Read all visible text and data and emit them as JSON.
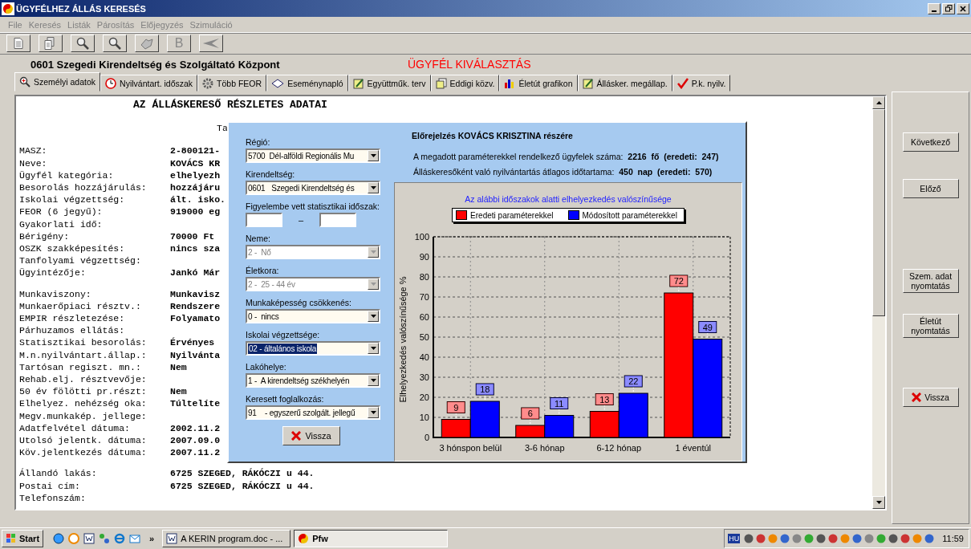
{
  "window": {
    "title": "ÜGYFÉLHEZ ÁLLÁS KERESÉS"
  },
  "menu": [
    {
      "label": "File",
      "disabled": true
    },
    {
      "label": "Keresés",
      "disabled": true
    },
    {
      "label": "Listák",
      "disabled": true
    },
    {
      "label": "Párosítás",
      "disabled": true
    },
    {
      "label": "Előjegyzés",
      "disabled": true
    },
    {
      "label": "Szimuláció",
      "disabled": true
    }
  ],
  "toolbar": [
    {
      "kind": "page"
    },
    {
      "kind": "pages"
    },
    {
      "kind": "zoom"
    },
    {
      "kind": "zoom"
    },
    {
      "kind": "print"
    },
    {
      "kind": "letter",
      "label": "B"
    },
    {
      "kind": "back"
    }
  ],
  "header": {
    "office": "0601  Szegedi Kirendeltség és Szolgáltató Központ",
    "mode": "ÜGYFÉL KIVÁLASZTÁS"
  },
  "tabs": [
    {
      "label": "Személyi adatok",
      "kind": "zoom",
      "selected": true
    },
    {
      "label": "Nyilvántart. időszak",
      "kind": "clock",
      "selected": false
    },
    {
      "label": "Több FEOR",
      "kind": "gear",
      "selected": false
    },
    {
      "label": "Eseménynapló",
      "kind": "book",
      "selected": false
    },
    {
      "label": "Együttműk. terv",
      "kind": "note",
      "selected": false
    },
    {
      "label": "Eddigi közv.",
      "kind": "pages",
      "selected": false
    },
    {
      "label": "Életút grafikon",
      "kind": "chart",
      "selected": false
    },
    {
      "label": "Állásker. megállap.",
      "kind": "note",
      "selected": false
    },
    {
      "label": "P.k. nyilv.",
      "kind": "check",
      "selected": false
    }
  ],
  "document": {
    "heading": "AZ ÁLLÁSKERESŐ RÉSZLETES ADATAI",
    "subheading": "Ta",
    "sections": [
      [
        {
          "label": "MASZ:",
          "value": "2-800121-"
        },
        {
          "label": "Neve:",
          "value": "KOVÁCS KR"
        },
        {
          "label": "Ügyfél kategória:",
          "value": "elhelyezh"
        },
        {
          "label": "Besorolás hozzájárulás:",
          "value": "hozzájáru"
        },
        {
          "label": "Iskolai végzettség:",
          "value": "ált. isko."
        },
        {
          "label": "FEOR (6 jegyű):",
          "value": "919000 eg"
        },
        {
          "label": "Gyakorlati idő:"
        },
        {
          "label": "Bérigény:",
          "value": "70000 Ft"
        },
        {
          "label": "OSZK szakképesítés:",
          "value": "nincs sza"
        },
        {
          "label": "Tanfolyami végzettség:"
        },
        {
          "label": "Ügyintézője:",
          "value": "Jankó Már"
        }
      ],
      [
        {
          "label": "Munkaviszony:",
          "value": "Munkavisz"
        },
        {
          "label": "Munkaerőpiaci résztv.:",
          "value": "Rendszere"
        },
        {
          "label": "EMPIR részletezése:",
          "value": "Folyamato"
        },
        {
          "label": "Párhuzamos ellátás:"
        },
        {
          "label": "Statisztikai besorolás:",
          "value": "Érvényes"
        },
        {
          "label": "M.n.nyilvántart.állap.:",
          "value": "Nyilvánta"
        },
        {
          "label": "Tartósan regiszt. mn.:",
          "value": "Nem"
        },
        {
          "label": "Rehab.elj. résztvevője:"
        },
        {
          "label": "50 év fölötti pr.részt:",
          "value": "Nem"
        },
        {
          "label": "Elhelyez. nehézség oka:",
          "value": "Túltelíte"
        },
        {
          "label": "Megv.munkakép. jellege:"
        },
        {
          "label": "Adatfelvétel dátuma:",
          "value": "2002.11.2"
        },
        {
          "label": "Utolsó jelentk. dátuma:",
          "value": "2007.09.0"
        },
        {
          "label": "Köv.jelentkezés dátuma:",
          "value": "2007.11.2"
        }
      ],
      [
        {
          "label": "Állandó lakás:",
          "value": "6725 SZEGED, RÁKÓCZI u 44."
        },
        {
          "label": "Postai cím:",
          "value": "6725 SZEGED, RÁKÓCZI u 44."
        },
        {
          "label": "Telefonszám:"
        }
      ]
    ]
  },
  "side_buttons": [
    {
      "label": "Következő",
      "kind": "plain"
    },
    {
      "label": "Előző",
      "kind": "plain"
    },
    {
      "label": "Szem. adat nyomtatás",
      "kind": "plain"
    },
    {
      "label": "Életút nyomtatás",
      "kind": "plain"
    },
    {
      "label": "Vissza",
      "kind": "close"
    }
  ],
  "dialog": {
    "fields": [
      {
        "label": "Régió:",
        "kind": "select",
        "value": "5700  Dél-alföldi Regionális Mu",
        "disabled": false,
        "highlighted": false
      },
      {
        "label": "Kirendeltség:",
        "kind": "select",
        "value": "0601   Szegedi Kirendeltség és",
        "disabled": false,
        "highlighted": false
      },
      {
        "label": "Figyelembe vett statisztikai időszak:",
        "kind": "range",
        "separator": "–"
      },
      {
        "label": "Neme:",
        "kind": "select",
        "value": "2 -  Nő",
        "disabled": true,
        "highlighted": false
      },
      {
        "label": "Életkora:",
        "kind": "select",
        "value": "2 -  25 - 44 év",
        "disabled": true,
        "highlighted": false
      },
      {
        "label": "Munkaképesség csökkenés:",
        "kind": "select",
        "value": "0 -  nincs",
        "disabled": false,
        "highlighted": false
      },
      {
        "label": "Iskolai végzettsége:",
        "kind": "select",
        "value": "02 - általános iskola",
        "disabled": false,
        "highlighted": true
      },
      {
        "label": "Lakóhelye:",
        "kind": "select",
        "value": "1 -  A kirendeltség székhelyén",
        "disabled": false,
        "highlighted": false
      },
      {
        "label": "Keresett foglalkozás:",
        "kind": "select",
        "value": "91    - egyszerű szolgált. jellegű",
        "disabled": false,
        "highlighted": false
      }
    ],
    "back_button": "Vissza",
    "title": "Előrejelzés KOVÁCS KRISZTINA részére",
    "stats": [
      "A megadott paraméterekkel rendelkező ügyfelek száma:  **2216  fő  (eredeti:  247)**",
      "Álláskeresőként való nyilvántartás átlagos időtartama:  **450  nap  (eredeti:  570)**"
    ],
    "chart_data": {
      "type": "bar",
      "title": "Az alábbi időszakok alatti elhelyezkedés valószínűsége",
      "ylabel": "Elhelyezkedés valószínűsége  %",
      "categories": [
        "3 hónspon belül",
        "3-6 hónap",
        "6-12 hónap",
        "1 éventúl"
      ],
      "series": [
        {
          "name": "Eredeti paraméterekkel",
          "color": "#ff0000",
          "values": [
            9,
            6,
            13,
            72
          ]
        },
        {
          "name": "Módosított paraméterekkel",
          "color": "#0000ff",
          "values": [
            18,
            11,
            22,
            49
          ]
        }
      ],
      "grid": true,
      "legend": "top",
      "ylim": [
        0,
        100
      ],
      "yticks": [
        0,
        10,
        20,
        30,
        40,
        50,
        60,
        70,
        80,
        90,
        100
      ],
      "data_labels": true
    }
  },
  "taskbar": {
    "start": "Start",
    "quick_launch": [
      {
        "kind": "browser"
      },
      {
        "kind": "clock"
      },
      {
        "kind": "word"
      },
      {
        "kind": "network"
      },
      {
        "kind": "ie"
      },
      {
        "kind": "mail"
      }
    ],
    "more": "»",
    "tasks": [
      {
        "label": "A KERIN program.doc - ...",
        "kind": "word",
        "selected": false
      },
      {
        "label": "Pfw",
        "kind": "app",
        "selected": true
      }
    ],
    "tray_label": "HU",
    "clock": "11:59"
  }
}
